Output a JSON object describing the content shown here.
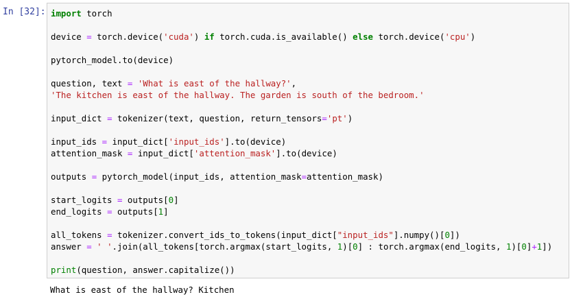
{
  "cell": {
    "prompt": "In [32]:",
    "lines": [
      [
        {
          "t": "import",
          "c": "kw"
        },
        {
          "t": " torch"
        }
      ],
      [],
      [
        {
          "t": "device "
        },
        {
          "t": "=",
          "c": "op"
        },
        {
          "t": " torch.device("
        },
        {
          "t": "'cuda'",
          "c": "str"
        },
        {
          "t": ") "
        },
        {
          "t": "if",
          "c": "kw"
        },
        {
          "t": " torch.cuda.is_available() "
        },
        {
          "t": "else",
          "c": "kw"
        },
        {
          "t": " torch.device("
        },
        {
          "t": "'cpu'",
          "c": "str"
        },
        {
          "t": ")"
        }
      ],
      [],
      [
        {
          "t": "pytorch_model.to(device)"
        }
      ],
      [],
      [
        {
          "t": "question, text "
        },
        {
          "t": "=",
          "c": "op"
        },
        {
          "t": " "
        },
        {
          "t": "'What is east of the hallway?'",
          "c": "str"
        },
        {
          "t": ","
        }
      ],
      [
        {
          "t": "'The kitchen is east of the hallway. The garden is south of the bedroom.'",
          "c": "str"
        }
      ],
      [],
      [
        {
          "t": "input_dict "
        },
        {
          "t": "=",
          "c": "op"
        },
        {
          "t": " tokenizer(text, question, return_tensors"
        },
        {
          "t": "=",
          "c": "op"
        },
        {
          "t": "'pt'",
          "c": "str"
        },
        {
          "t": ")"
        }
      ],
      [],
      [
        {
          "t": "input_ids "
        },
        {
          "t": "=",
          "c": "op"
        },
        {
          "t": " input_dict["
        },
        {
          "t": "'input_ids'",
          "c": "str"
        },
        {
          "t": "].to(device)"
        }
      ],
      [
        {
          "t": "attention_mask "
        },
        {
          "t": "=",
          "c": "op"
        },
        {
          "t": " input_dict["
        },
        {
          "t": "'attention_mask'",
          "c": "str"
        },
        {
          "t": "].to(device)"
        }
      ],
      [],
      [
        {
          "t": "outputs "
        },
        {
          "t": "=",
          "c": "op"
        },
        {
          "t": " pytorch_model(input_ids, attention_mask"
        },
        {
          "t": "=",
          "c": "op"
        },
        {
          "t": "attention_mask)"
        }
      ],
      [],
      [
        {
          "t": "start_logits "
        },
        {
          "t": "=",
          "c": "op"
        },
        {
          "t": " outputs["
        },
        {
          "t": "0",
          "c": "num"
        },
        {
          "t": "]"
        }
      ],
      [
        {
          "t": "end_logits "
        },
        {
          "t": "=",
          "c": "op"
        },
        {
          "t": " outputs["
        },
        {
          "t": "1",
          "c": "num"
        },
        {
          "t": "]"
        }
      ],
      [],
      [
        {
          "t": "all_tokens "
        },
        {
          "t": "=",
          "c": "op"
        },
        {
          "t": " tokenizer.convert_ids_to_tokens(input_dict["
        },
        {
          "t": "\"input_ids\"",
          "c": "str"
        },
        {
          "t": "].numpy()["
        },
        {
          "t": "0",
          "c": "num"
        },
        {
          "t": "])"
        }
      ],
      [
        {
          "t": "answer "
        },
        {
          "t": "=",
          "c": "op"
        },
        {
          "t": " "
        },
        {
          "t": "' '",
          "c": "str"
        },
        {
          "t": ".join(all_tokens[torch.argmax(start_logits, "
        },
        {
          "t": "1",
          "c": "num"
        },
        {
          "t": ")["
        },
        {
          "t": "0",
          "c": "num"
        },
        {
          "t": "] : torch.argmax(end_logits, "
        },
        {
          "t": "1",
          "c": "num"
        },
        {
          "t": ")["
        },
        {
          "t": "0",
          "c": "num"
        },
        {
          "t": "]"
        },
        {
          "t": "+",
          "c": "op"
        },
        {
          "t": "1",
          "c": "num"
        },
        {
          "t": "])"
        }
      ],
      [],
      [
        {
          "t": "print",
          "c": "bi"
        },
        {
          "t": "(question, answer.capitalize())"
        }
      ]
    ],
    "output": "What is east of the hallway? Kitchen"
  }
}
